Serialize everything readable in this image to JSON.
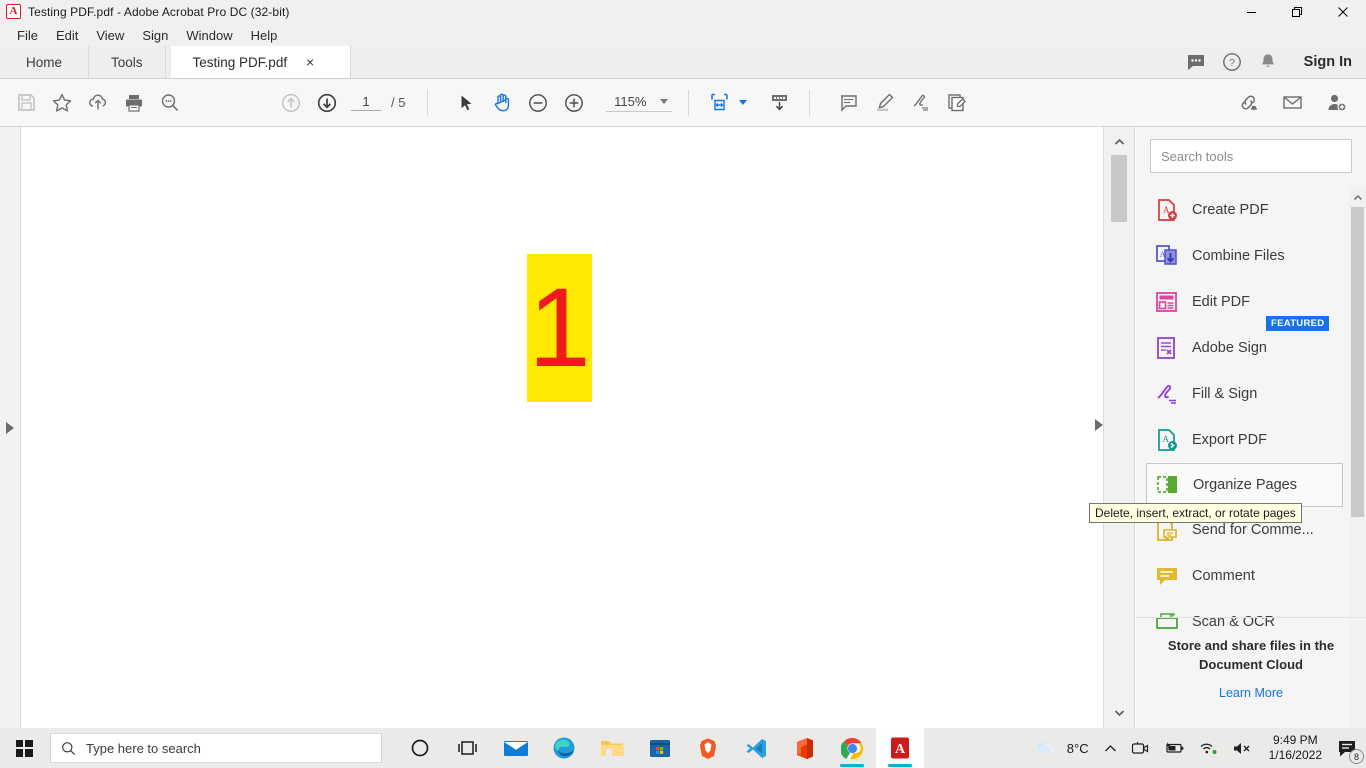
{
  "window": {
    "title": "Testing PDF.pdf - Adobe Acrobat Pro DC (32-bit)",
    "app_icon": "acrobat-icon",
    "controls": {
      "minimize": "minimize-icon",
      "restore": "restore-icon",
      "close": "close-icon"
    }
  },
  "menubar": {
    "items": [
      {
        "label": "File"
      },
      {
        "label": "Edit"
      },
      {
        "label": "View"
      },
      {
        "label": "Sign"
      },
      {
        "label": "Window"
      },
      {
        "label": "Help"
      }
    ]
  },
  "tabbar": {
    "home": "Home",
    "tools": "Tools",
    "document_tab": "Testing PDF.pdf",
    "close_glyph": "×",
    "right_icons": [
      "chat-bubble-icon",
      "help-circle-icon",
      "bell-icon"
    ],
    "sign_in": "Sign In"
  },
  "toolbar": {
    "save": "save-icon",
    "star": "star-icon",
    "cloud_upload": "cloud-upload-icon",
    "print": "print-icon",
    "search": "search-zoom-icon",
    "prev_page": "arrow-up-circle-icon",
    "next_page": "arrow-down-circle-icon",
    "page_current": "1",
    "page_total": "/ 5",
    "select_tool": "cursor-arrow-icon",
    "hand_tool": "hand-icon",
    "zoom_out": "zoom-out-icon",
    "zoom_in": "zoom-in-icon",
    "zoom_level": "115%",
    "fit_page": "fit-page-icon",
    "scroll_mode": "page-scroll-icon",
    "comment": "comment-icon",
    "highlight": "highlighter-icon",
    "sign": "sign-pen-icon",
    "edit_pdf": "edit-page-icon",
    "share_link": "link-share-icon",
    "email": "email-icon",
    "add_person": "add-person-icon"
  },
  "document": {
    "page_text": "1",
    "highlight_color": "#ffe900",
    "text_color": "#ee1b1b",
    "left_panel_arrow": "expand-left-panel-icon",
    "right_panel_arrow": "expand-right-panel-icon"
  },
  "tools_panel": {
    "search_placeholder": "Search tools",
    "search_value": "",
    "items": [
      {
        "label": "Create PDF",
        "icon": "create-pdf-icon",
        "color": "#d83b3b",
        "badge": ""
      },
      {
        "label": "Combine Files",
        "icon": "combine-files-icon",
        "color": "#4b53c4",
        "badge": ""
      },
      {
        "label": "Edit PDF",
        "icon": "edit-pdf-icon",
        "color": "#e0439b",
        "badge": ""
      },
      {
        "label": "Adobe Sign",
        "icon": "adobe-sign-icon",
        "color": "#9b3fc9",
        "badge": "FEATURED"
      },
      {
        "label": "Fill & Sign",
        "icon": "fill-and-sign-icon",
        "color": "#8d3fd4",
        "badge": ""
      },
      {
        "label": "Export PDF",
        "icon": "export-pdf-icon",
        "color": "#14998d",
        "badge": ""
      },
      {
        "label": "Organize Pages",
        "icon": "organize-pages-icon",
        "color": "#5aa832",
        "badge": ""
      },
      {
        "label": "Send for Comme...",
        "icon": "send-for-comment-icon",
        "color": "#d6b429",
        "badge": ""
      },
      {
        "label": "Comment",
        "icon": "comment-tool-icon",
        "color": "#e3b82a",
        "badge": ""
      },
      {
        "label": "Scan & OCR",
        "icon": "scan-ocr-icon",
        "color": "#4aa83a",
        "badge": ""
      }
    ],
    "hovered_item_index": 6,
    "tooltip": "Delete, insert, extract, or rotate pages",
    "promo_title": "Store and share files in the Document Cloud",
    "promo_link": "Learn More"
  },
  "taskbar": {
    "start": "windows-start-icon",
    "search_placeholder": "Type here to search",
    "apps": [
      {
        "name": "cortana-icon"
      },
      {
        "name": "task-view-icon"
      },
      {
        "name": "mail-icon"
      },
      {
        "name": "edge-icon"
      },
      {
        "name": "file-explorer-icon"
      },
      {
        "name": "microsoft-store-icon"
      },
      {
        "name": "brave-icon"
      },
      {
        "name": "vs-code-icon"
      },
      {
        "name": "office-icon"
      },
      {
        "name": "chrome-icon"
      },
      {
        "name": "acrobat-icon"
      }
    ],
    "weather_temp": "8°C",
    "tray_icons": [
      "chevron-up-icon",
      "camera-icon",
      "battery-icon",
      "wifi-icon",
      "volume-muted-icon"
    ],
    "time": "9:49 PM",
    "date": "1/16/2022",
    "notification_count": "8"
  }
}
